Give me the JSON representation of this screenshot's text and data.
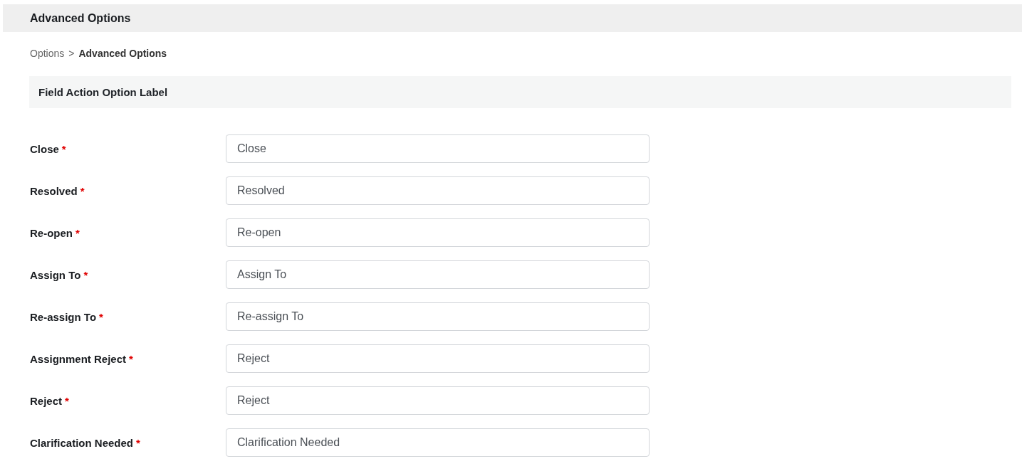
{
  "header": {
    "title": "Advanced Options"
  },
  "breadcrumb": {
    "items": [
      {
        "label": "Options",
        "current": false
      },
      {
        "label": "Advanced Options",
        "current": true
      }
    ],
    "separator": ">"
  },
  "section": {
    "title": "Field Action Option Label"
  },
  "fields": [
    {
      "label": "Close",
      "required_mark": "*",
      "value": "Close"
    },
    {
      "label": "Resolved",
      "required_mark": "*",
      "value": "Resolved"
    },
    {
      "label": "Re-open",
      "required_mark": "*",
      "value": "Re-open"
    },
    {
      "label": "Assign To",
      "required_mark": "*",
      "value": "Assign To"
    },
    {
      "label": "Re-assign To",
      "required_mark": "*",
      "value": "Re-assign To"
    },
    {
      "label": "Assignment Reject",
      "required_mark": "*",
      "value": "Reject"
    },
    {
      "label": "Reject",
      "required_mark": "*",
      "value": "Reject"
    },
    {
      "label": "Clarification Needed",
      "required_mark": "*",
      "value": "Clarification Needed"
    }
  ]
}
